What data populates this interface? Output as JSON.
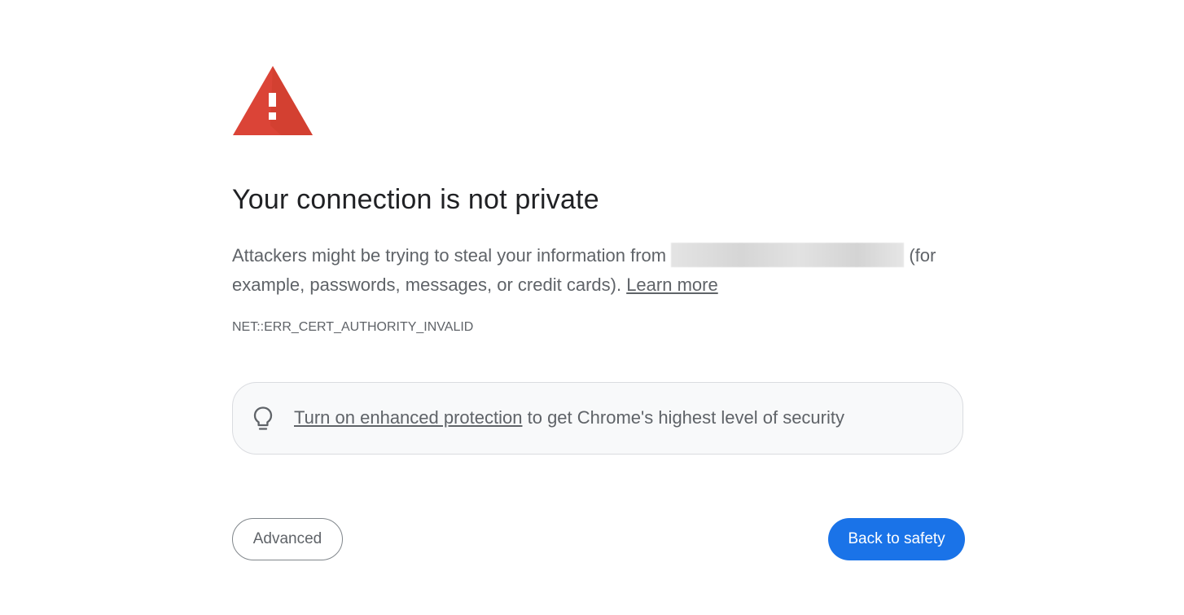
{
  "colors": {
    "warning_red": "#db4437",
    "primary_blue": "#1a73e8",
    "text_dark": "#202124",
    "text_muted": "#5f6368"
  },
  "icons": {
    "warning": "warning-triangle-icon",
    "bulb": "lightbulb-icon"
  },
  "interstitial": {
    "title": "Your connection is not private",
    "body_prefix": "Attackers might be trying to steal your information from ",
    "body_suffix": " (for example, passwords, messages, or credit cards). ",
    "learn_more": "Learn more",
    "error_code": "NET::ERR_CERT_AUTHORITY_INVALID"
  },
  "enhanced_protection": {
    "link_text": "Turn on enhanced protection",
    "suffix": " to get Chrome's highest level of security"
  },
  "buttons": {
    "advanced": "Advanced",
    "back_to_safety": "Back to safety"
  }
}
